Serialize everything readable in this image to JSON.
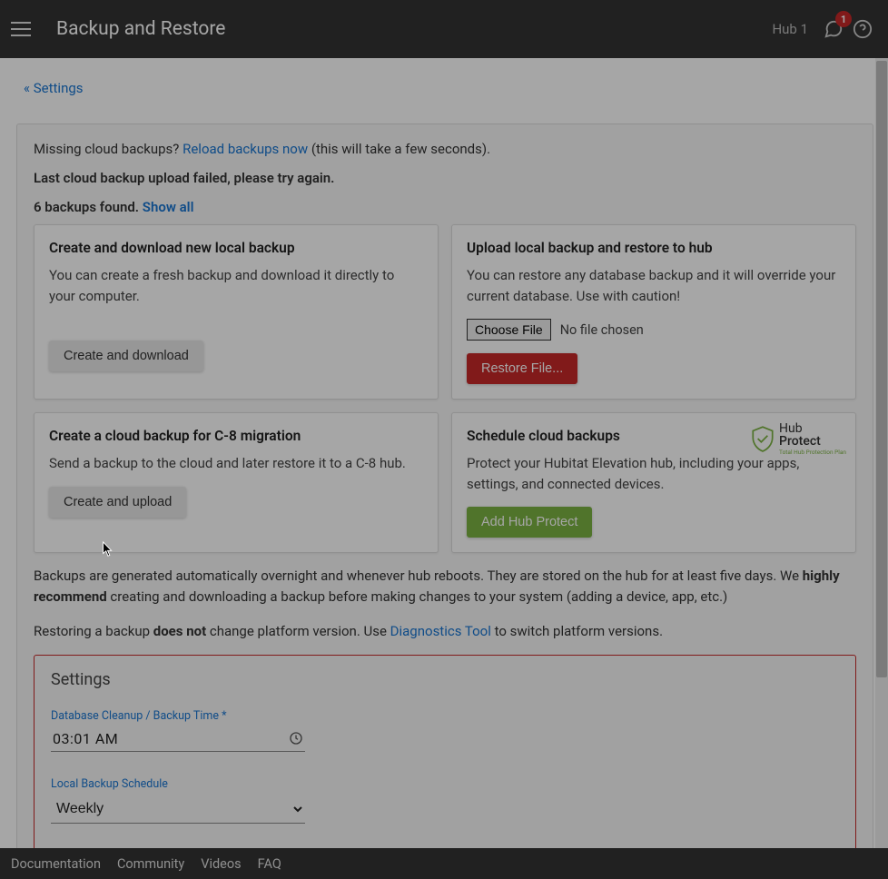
{
  "header": {
    "title": "Backup and Restore",
    "hub_label": "Hub 1",
    "notif_count": "1"
  },
  "breadcrumb": "« Settings",
  "missing": {
    "prefix": "Missing cloud backups? ",
    "link": "Reload backups now",
    "suffix": " (this will take a few seconds)."
  },
  "error_msg": "Last cloud backup upload failed, please try again.",
  "found": {
    "text": "6 backups found. ",
    "link": "Show all"
  },
  "cards": {
    "local_new": {
      "title": "Create and download new local backup",
      "body": "You can create a fresh backup and download it directly to your computer.",
      "btn": "Create and download"
    },
    "upload_restore": {
      "title": "Upload local backup and restore to hub",
      "body": "You can restore any database backup and it will override your current database. Use with caution!",
      "choose": "Choose File",
      "nofile": "No file chosen",
      "btn": "Restore File..."
    },
    "cloud_migrate": {
      "title": "Create a cloud backup for C-8 migration",
      "body": "Send a backup to the cloud and later restore it to a C-8 hub.",
      "btn": "Create and upload"
    },
    "schedule_cloud": {
      "title": "Schedule cloud backups",
      "body": "Protect your Hubitat Elevation hub, including your apps, settings, and connected devices.",
      "btn": "Add Hub Protect",
      "logo_l1": "Hub",
      "logo_l2": "Protect",
      "logo_l3": "Total Hub Protection Plan"
    }
  },
  "info1": {
    "pre": "Backups are generated automatically overnight and whenever hub reboots. They are stored on the hub for at least five days. We ",
    "strong": "highly recommend",
    "post": " creating and downloading a backup before making changes to your system (adding a device, app, etc.)"
  },
  "info2": {
    "pre": "Restoring a backup ",
    "strong": "does not",
    "mid": " change platform version. Use ",
    "link": "Diagnostics Tool",
    "post": " to switch platform versions."
  },
  "settings": {
    "heading": "Settings",
    "time_label": "Database Cleanup / Backup Time *",
    "time_value": "03:01 AM",
    "sched_label": "Local Backup Schedule",
    "sched_value": "Weekly"
  },
  "footer": {
    "doc": "Documentation",
    "community": "Community",
    "videos": "Videos",
    "faq": "FAQ"
  }
}
